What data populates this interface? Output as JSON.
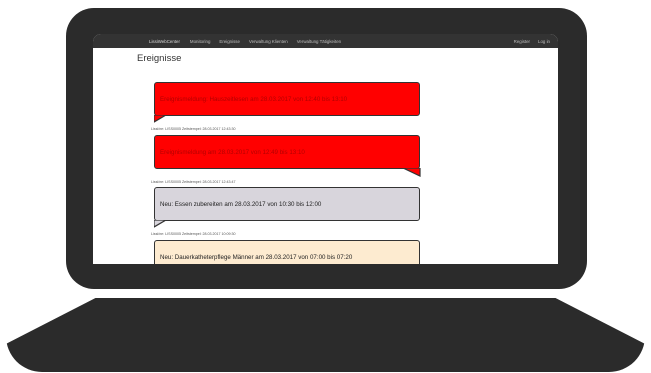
{
  "navbar": {
    "brand": "LissiWebCenter",
    "links": [
      "Monitoring",
      "Ereignisse",
      "Verwaltung Klienten",
      "Verwaltung Tätigkeiten"
    ],
    "register": "Register",
    "login": "Log in"
  },
  "page": {
    "title": "Ereignisse"
  },
  "events": [
    {
      "text": "Ereignismeldung: Hauszeitlesen am 28.03.2017 von 12:40 bis 13:10",
      "meta": "Lissi/ne: LISS0005 Zeitstempel: 28.03.2017 12:43:30"
    },
    {
      "text": "Ereignismeldung am 28.03.2017 von 12:49 bis 13:10",
      "meta": "Lissi/ne: LISS0005 Zeitstempel: 28.03.2017 12:43:47"
    },
    {
      "text": "Neu: Essen zubereiten am 28.03.2017 von 10:30 bis 12:00",
      "meta": "Lissi/ne: LISS0005 Zeitstempel: 28.03.2017 10:09:30"
    },
    {
      "text": "Neu: Dauerkatheterpflege Männer am 28.03.2017 von 07:00 bis 07:20",
      "meta": ""
    }
  ],
  "colors": {
    "alert": "#ff0000",
    "info": "#d8d5dc",
    "note": "#fdebd0",
    "frame": "#2b2b2b"
  }
}
